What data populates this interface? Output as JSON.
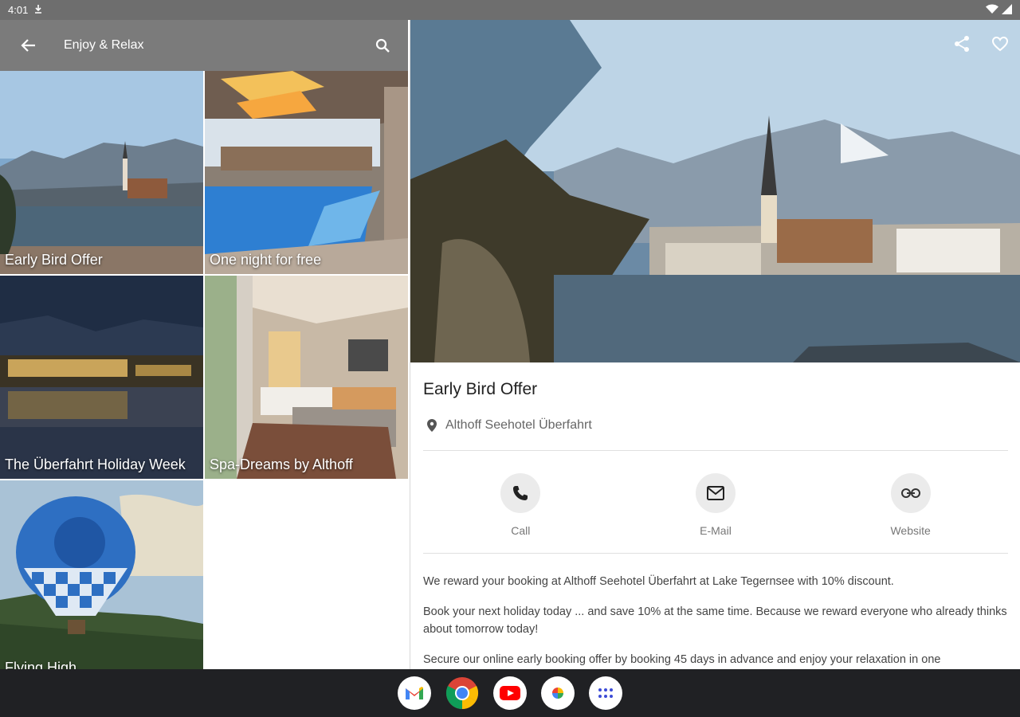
{
  "status": {
    "time": "4:01"
  },
  "app_bar": {
    "title": "Enjoy & Relax"
  },
  "tiles": [
    {
      "caption": "Early Bird Offer"
    },
    {
      "caption": "One night for free"
    },
    {
      "caption": "The Überfahrt Holiday Week"
    },
    {
      "caption": "Spa-Dreams by Althoff"
    },
    {
      "caption": "Flying High"
    }
  ],
  "detail": {
    "title": "Early Bird Offer",
    "location": "Althoff Seehotel Überfahrt",
    "actions": {
      "call": "Call",
      "email": "E-Mail",
      "website": "Website"
    },
    "paragraphs": [
      "We reward your booking at Althoff Seehotel Überfahrt at Lake Tegernsee with 10% discount.",
      "Book your next holiday today ... and save 10% at the same time. Because we reward everyone who already thinks about tomorrow today!",
      "Secure our online early booking offer by booking 45 days in advance and enjoy your relaxation in one"
    ]
  },
  "dock": [
    "gmail-icon",
    "chrome-icon",
    "youtube-icon",
    "photos-icon",
    "apps-icon"
  ]
}
